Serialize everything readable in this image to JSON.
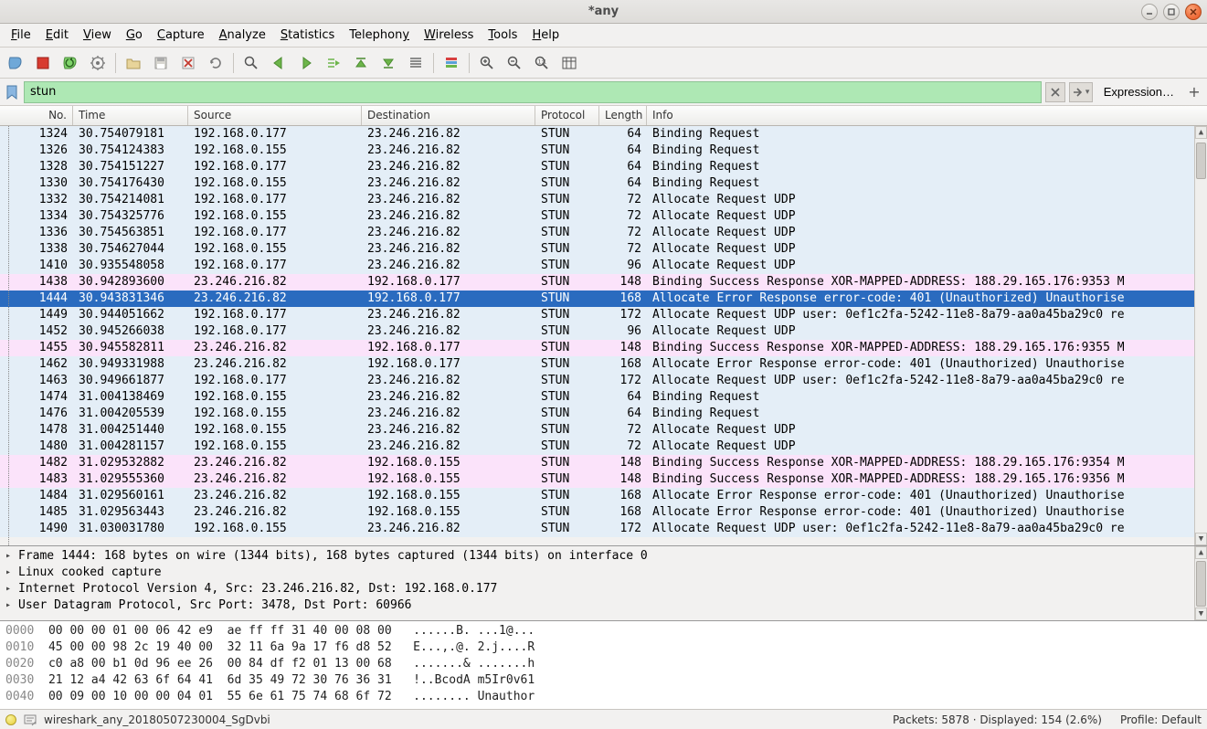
{
  "window": {
    "title": "*any"
  },
  "menu": [
    "File",
    "Edit",
    "View",
    "Go",
    "Capture",
    "Analyze",
    "Statistics",
    "Telephony",
    "Wireless",
    "Tools",
    "Help"
  ],
  "filter": {
    "value": "stun",
    "expression_label": "Expression…"
  },
  "columns": {
    "no": "No.",
    "time": "Time",
    "source": "Source",
    "destination": "Destination",
    "protocol": "Protocol",
    "length": "Length",
    "info": "Info"
  },
  "packets": [
    {
      "no": 1324,
      "time": "30.754079181",
      "src": "192.168.0.177",
      "dst": "23.246.216.82",
      "proto": "STUN",
      "len": 64,
      "info": "Binding Request",
      "bg": 0
    },
    {
      "no": 1326,
      "time": "30.754124383",
      "src": "192.168.0.155",
      "dst": "23.246.216.82",
      "proto": "STUN",
      "len": 64,
      "info": "Binding Request",
      "bg": 0
    },
    {
      "no": 1328,
      "time": "30.754151227",
      "src": "192.168.0.177",
      "dst": "23.246.216.82",
      "proto": "STUN",
      "len": 64,
      "info": "Binding Request",
      "bg": 0
    },
    {
      "no": 1330,
      "time": "30.754176430",
      "src": "192.168.0.155",
      "dst": "23.246.216.82",
      "proto": "STUN",
      "len": 64,
      "info": "Binding Request",
      "bg": 0
    },
    {
      "no": 1332,
      "time": "30.754214081",
      "src": "192.168.0.177",
      "dst": "23.246.216.82",
      "proto": "STUN",
      "len": 72,
      "info": "Allocate Request UDP",
      "bg": 0
    },
    {
      "no": 1334,
      "time": "30.754325776",
      "src": "192.168.0.155",
      "dst": "23.246.216.82",
      "proto": "STUN",
      "len": 72,
      "info": "Allocate Request UDP",
      "bg": 0
    },
    {
      "no": 1336,
      "time": "30.754563851",
      "src": "192.168.0.177",
      "dst": "23.246.216.82",
      "proto": "STUN",
      "len": 72,
      "info": "Allocate Request UDP",
      "bg": 0
    },
    {
      "no": 1338,
      "time": "30.754627044",
      "src": "192.168.0.155",
      "dst": "23.246.216.82",
      "proto": "STUN",
      "len": 72,
      "info": "Allocate Request UDP",
      "bg": 0
    },
    {
      "no": 1410,
      "time": "30.935548058",
      "src": "192.168.0.177",
      "dst": "23.246.216.82",
      "proto": "STUN",
      "len": 96,
      "info": "Allocate Request UDP",
      "bg": 0
    },
    {
      "no": 1438,
      "time": "30.942893600",
      "src": "23.246.216.82",
      "dst": "192.168.0.177",
      "proto": "STUN",
      "len": 148,
      "info": "Binding Success Response XOR-MAPPED-ADDRESS: 188.29.165.176:9353 M",
      "bg": 1
    },
    {
      "no": 1444,
      "time": "30.943831346",
      "src": "23.246.216.82",
      "dst": "192.168.0.177",
      "proto": "STUN",
      "len": 168,
      "info": "Allocate Error Response error-code: 401 (Unauthorized) Unauthorise",
      "bg": 0,
      "selected": true
    },
    {
      "no": 1449,
      "time": "30.944051662",
      "src": "192.168.0.177",
      "dst": "23.246.216.82",
      "proto": "STUN",
      "len": 172,
      "info": "Allocate Request UDP user: 0ef1c2fa-5242-11e8-8a79-aa0a45ba29c0 re",
      "bg": 0
    },
    {
      "no": 1452,
      "time": "30.945266038",
      "src": "192.168.0.177",
      "dst": "23.246.216.82",
      "proto": "STUN",
      "len": 96,
      "info": "Allocate Request UDP",
      "bg": 0
    },
    {
      "no": 1455,
      "time": "30.945582811",
      "src": "23.246.216.82",
      "dst": "192.168.0.177",
      "proto": "STUN",
      "len": 148,
      "info": "Binding Success Response XOR-MAPPED-ADDRESS: 188.29.165.176:9355 M",
      "bg": 1
    },
    {
      "no": 1462,
      "time": "30.949331988",
      "src": "23.246.216.82",
      "dst": "192.168.0.177",
      "proto": "STUN",
      "len": 168,
      "info": "Allocate Error Response error-code: 401 (Unauthorized) Unauthorise",
      "bg": 0
    },
    {
      "no": 1463,
      "time": "30.949661877",
      "src": "192.168.0.177",
      "dst": "23.246.216.82",
      "proto": "STUN",
      "len": 172,
      "info": "Allocate Request UDP user: 0ef1c2fa-5242-11e8-8a79-aa0a45ba29c0 re",
      "bg": 0
    },
    {
      "no": 1474,
      "time": "31.004138469",
      "src": "192.168.0.155",
      "dst": "23.246.216.82",
      "proto": "STUN",
      "len": 64,
      "info": "Binding Request",
      "bg": 0
    },
    {
      "no": 1476,
      "time": "31.004205539",
      "src": "192.168.0.155",
      "dst": "23.246.216.82",
      "proto": "STUN",
      "len": 64,
      "info": "Binding Request",
      "bg": 0
    },
    {
      "no": 1478,
      "time": "31.004251440",
      "src": "192.168.0.155",
      "dst": "23.246.216.82",
      "proto": "STUN",
      "len": 72,
      "info": "Allocate Request UDP",
      "bg": 0
    },
    {
      "no": 1480,
      "time": "31.004281157",
      "src": "192.168.0.155",
      "dst": "23.246.216.82",
      "proto": "STUN",
      "len": 72,
      "info": "Allocate Request UDP",
      "bg": 0
    },
    {
      "no": 1482,
      "time": "31.029532882",
      "src": "23.246.216.82",
      "dst": "192.168.0.155",
      "proto": "STUN",
      "len": 148,
      "info": "Binding Success Response XOR-MAPPED-ADDRESS: 188.29.165.176:9354 M",
      "bg": 1
    },
    {
      "no": 1483,
      "time": "31.029555360",
      "src": "23.246.216.82",
      "dst": "192.168.0.155",
      "proto": "STUN",
      "len": 148,
      "info": "Binding Success Response XOR-MAPPED-ADDRESS: 188.29.165.176:9356 M",
      "bg": 1
    },
    {
      "no": 1484,
      "time": "31.029560161",
      "src": "23.246.216.82",
      "dst": "192.168.0.155",
      "proto": "STUN",
      "len": 168,
      "info": "Allocate Error Response error-code: 401 (Unauthorized) Unauthorise",
      "bg": 0
    },
    {
      "no": 1485,
      "time": "31.029563443",
      "src": "23.246.216.82",
      "dst": "192.168.0.155",
      "proto": "STUN",
      "len": 168,
      "info": "Allocate Error Response error-code: 401 (Unauthorized) Unauthorise",
      "bg": 0
    },
    {
      "no": 1490,
      "time": "31.030031780",
      "src": "192.168.0.155",
      "dst": "23.246.216.82",
      "proto": "STUN",
      "len": 172,
      "info": "Allocate Request UDP user: 0ef1c2fa-5242-11e8-8a79-aa0a45ba29c0 re",
      "bg": 0
    }
  ],
  "details": [
    "Frame 1444: 168 bytes on wire (1344 bits), 168 bytes captured (1344 bits) on interface 0",
    "Linux cooked capture",
    "Internet Protocol Version 4, Src: 23.246.216.82, Dst: 192.168.0.177",
    "User Datagram Protocol, Src Port: 3478, Dst Port: 60966"
  ],
  "hex": [
    {
      "off": "0000",
      "bytes": "00 00 00 01 00 06 42 e9  ae ff ff 31 40 00 08 00",
      "ascii": "......B. ...1@..."
    },
    {
      "off": "0010",
      "bytes": "45 00 00 98 2c 19 40 00  32 11 6a 9a 17 f6 d8 52",
      "ascii": "E...,.@. 2.j....R"
    },
    {
      "off": "0020",
      "bytes": "c0 a8 00 b1 0d 96 ee 26  00 84 df f2 01 13 00 68",
      "ascii": ".......& .......h"
    },
    {
      "off": "0030",
      "bytes": "21 12 a4 42 63 6f 64 41  6d 35 49 72 30 76 36 31",
      "ascii": "!..BcodA m5Ir0v61"
    },
    {
      "off": "0040",
      "bytes": "00 09 00 10 00 00 04 01  55 6e 61 75 74 68 6f 72",
      "ascii": "........ Unauthor"
    }
  ],
  "status": {
    "file": "wireshark_any_20180507230004_SgDvbi",
    "packets": "Packets: 5878 · Displayed: 154 (2.6%)",
    "profile": "Profile: Default"
  }
}
